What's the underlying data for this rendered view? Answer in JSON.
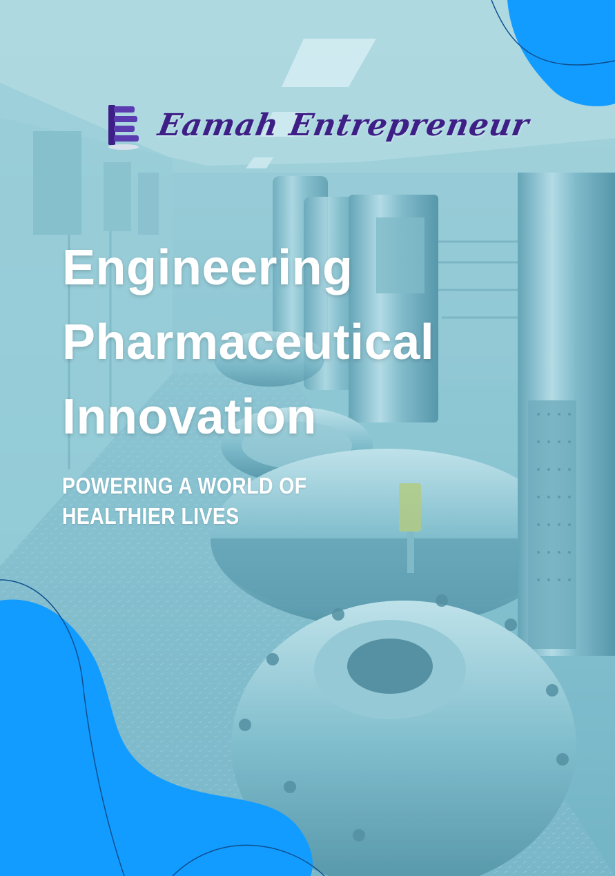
{
  "brand": {
    "name": "Eamah Entrepreneur",
    "logo_icon": "stacked-e-logo-icon"
  },
  "headline": {
    "lines": [
      "Engineering",
      "Pharmaceutical",
      "Innovation"
    ]
  },
  "tagline": {
    "lines": [
      "POWERING A WORLD OF",
      "HEALTHIER LIVES"
    ]
  },
  "colors": {
    "accent_blue": "#139cff",
    "brand_purple": "#3e1f86",
    "text_white": "#ffffff",
    "photo_tint": "#8fc6d3"
  }
}
